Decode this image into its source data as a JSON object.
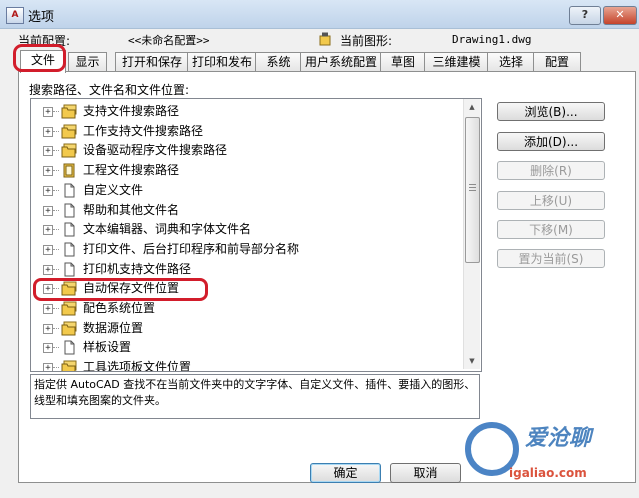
{
  "window": {
    "title": "选项",
    "help_label": "?",
    "close_label": "✕"
  },
  "info": {
    "profile_label": "当前配置:",
    "profile_value": "<<未命名配置>>",
    "drawing_label": "当前图形:",
    "drawing_value": "Drawing1.dwg"
  },
  "tabs": [
    "文件",
    "显示",
    "打开和保存",
    "打印和发布",
    "系统",
    "用户系统配置",
    "草图",
    "三维建模",
    "选择",
    "配置"
  ],
  "active_tab": "文件",
  "section_label": "搜索路径、文件名和文件位置:",
  "tree": [
    {
      "label": "支持文件搜索路径",
      "icon": "folders-icon"
    },
    {
      "label": "工作支持文件搜索路径",
      "icon": "folders-icon"
    },
    {
      "label": "设备驱动程序文件搜索路径",
      "icon": "folders-icon"
    },
    {
      "label": "工程文件搜索路径",
      "icon": "binder-icon"
    },
    {
      "label": "自定义文件",
      "icon": "document-icon"
    },
    {
      "label": "帮助和其他文件名",
      "icon": "document-icon"
    },
    {
      "label": "文本编辑器、词典和字体文件名",
      "icon": "document-icon"
    },
    {
      "label": "打印文件、后台打印程序和前导部分名称",
      "icon": "document-icon"
    },
    {
      "label": "打印机支持文件路径",
      "icon": "document-icon"
    },
    {
      "label": "自动保存文件位置",
      "icon": "folders-icon"
    },
    {
      "label": "配色系统位置",
      "icon": "folders-icon"
    },
    {
      "label": "数据源位置",
      "icon": "folders-icon"
    },
    {
      "label": "样板设置",
      "icon": "document-icon"
    },
    {
      "label": "工具选项板文件位置",
      "icon": "folders-icon"
    }
  ],
  "description": "指定供 AutoCAD 查找不在当前文件夹中的文字字体、自定义文件、插件、要插入的图形、线型和填充图案的文件夹。",
  "buttons": {
    "browse": "浏览(B)...",
    "add": "添加(D)...",
    "remove": "删除(R)",
    "move_up": "上移(U)",
    "move_down": "下移(M)",
    "set_current": "置为当前(S)",
    "ok": "确定",
    "cancel": "取消"
  },
  "watermark": {
    "brand": "爱沧聊",
    "url": "igaliao.com"
  },
  "colors": {
    "highlight_circle": "#d21d2b",
    "folder": "#f2c94c"
  }
}
